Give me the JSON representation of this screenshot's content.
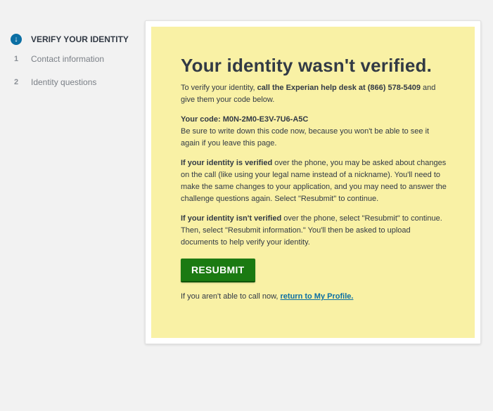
{
  "sidebar": {
    "steps": [
      {
        "label": "VERIFY YOUR IDENTITY",
        "icon": "arrow-down-icon"
      },
      {
        "number": "1",
        "label": "Contact information"
      },
      {
        "number": "2",
        "label": "Identity questions"
      }
    ]
  },
  "main": {
    "title": "Your identity wasn't verified.",
    "p1": {
      "pre": "To verify your identity, ",
      "bold": "call the Experian help desk at (866) 578-5409",
      "post": " and give them your code below."
    },
    "code": {
      "label": "Your code: M0N-2M0-E3V-7U6-A5C",
      "note": "Be sure to write down this code now, because you won't be able to see it again if you leave this page."
    },
    "p3": {
      "bold": "If your identity is verified",
      "rest": " over the phone, you may be asked about changes on the call (like using your legal name instead of a nickname). You'll need to make the same changes to your application, and you may need to answer the challenge questions again. Select \"Resubmit\" to continue."
    },
    "p4": {
      "bold": "If your identity isn't verified",
      "rest": " over the phone, select \"Resubmit\" to continue. Then, select \"Resubmit information.\" You'll then be asked to upload documents to help verify your identity."
    },
    "button_label": "RESUBMIT",
    "footer": {
      "pre": "If you aren't able to call now, ",
      "link": "return to My Profile."
    }
  },
  "colors": {
    "background": "#f2f2f2",
    "panel": "#f9f1a5",
    "button": "#1b7a12",
    "accent": "#0b6fa4"
  }
}
